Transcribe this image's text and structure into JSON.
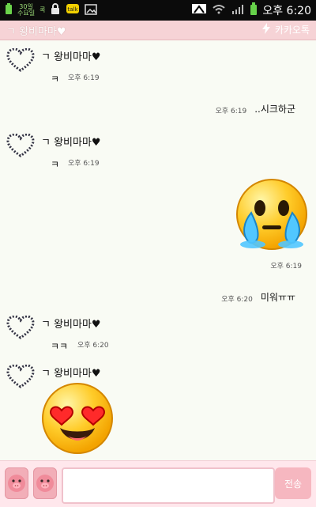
{
  "status_bar": {
    "left_icon_1": "battery-status-icon",
    "left_text_1_top": "30일",
    "left_text_1_bottom": "수요일",
    "left_text_2": "콕",
    "left_icon_3": "lock-icon",
    "left_icon_4": "kakao-icon",
    "left_icon_5": "image-icon",
    "right_icon_1": "tools-icon",
    "right_icon_2": "wifi-icon",
    "right_icon_3": "signal-icon",
    "right_icon_4": "battery-icon",
    "time": "오후 6:20"
  },
  "title_bar": {
    "title": "ㄱ 왕비마마♥",
    "app_name": "카카오톡",
    "app_icon": "lightning-icon"
  },
  "messages": [
    {
      "type": "in",
      "name": "ㄱ 왕비마마♥",
      "text": "ㅋ",
      "time": "오후 6:19"
    },
    {
      "type": "out",
      "text": "..시크하군",
      "time": "오후 6:19"
    },
    {
      "type": "in",
      "name": "ㄱ 왕비마마♥",
      "text": "ㅋ",
      "time": "오후 6:19"
    },
    {
      "type": "out-emoji",
      "emoji": "crying-face-emoji",
      "time": "오후 6:19"
    },
    {
      "type": "out",
      "text": "미워ㅠㅠ",
      "time": "오후 6:20"
    },
    {
      "type": "in",
      "name": "ㄱ 왕비마마♥",
      "text": "ㅋㅋ",
      "time": "오후 6:20"
    },
    {
      "type": "in-emoji",
      "name": "ㄱ 왕비마마♥",
      "emoji": "heart-eyes-face-emoji"
    }
  ],
  "input_bar": {
    "left_button_1_icon": "pig-face-icon",
    "left_button_2_icon": "pig-face-icon",
    "input_placeholder": "",
    "send_label": "전송"
  }
}
